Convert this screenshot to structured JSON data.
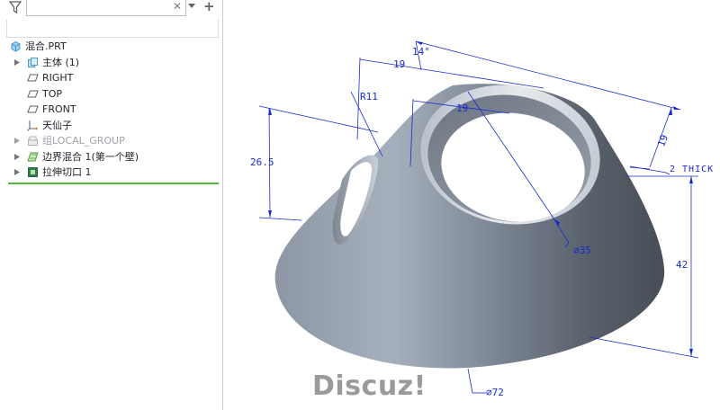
{
  "tree": {
    "root": "混合.PRT",
    "items": [
      {
        "label": "主体 (1)",
        "expandable": true,
        "disabled": false,
        "icon": "body-icon"
      },
      {
        "label": "RIGHT",
        "expandable": false,
        "disabled": false,
        "icon": "datum-plane-icon"
      },
      {
        "label": "TOP",
        "expandable": false,
        "disabled": false,
        "icon": "datum-plane-icon"
      },
      {
        "label": "FRONT",
        "expandable": false,
        "disabled": false,
        "icon": "datum-plane-icon"
      },
      {
        "label": "天仙子",
        "expandable": false,
        "disabled": false,
        "icon": "coordinate-system-icon"
      },
      {
        "label": "组LOCAL_GROUP",
        "expandable": true,
        "disabled": true,
        "icon": "group-icon"
      },
      {
        "label": "边界混合 1(第一个壁)",
        "expandable": true,
        "disabled": false,
        "icon": "boundary-blend-icon"
      },
      {
        "label": "拉伸切口 1",
        "expandable": true,
        "disabled": false,
        "icon": "extrude-cut-icon"
      }
    ]
  },
  "dimensions": {
    "angle": "14°",
    "d19_top": "19",
    "d19_inner": "19",
    "d19_right": "19",
    "r11": "R11",
    "h26_5": "26.5",
    "thick": "2 THICK",
    "dia35": "⌀35",
    "h42": "42",
    "dia72": "⌀72"
  },
  "watermark": "Discuz!",
  "colors": {
    "dimension_line": "#1a2bd0",
    "accent_green": "#53b83c"
  }
}
